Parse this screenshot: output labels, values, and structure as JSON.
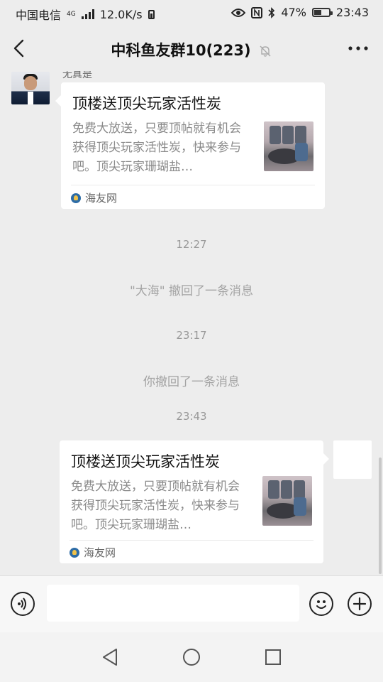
{
  "status_bar": {
    "carrier": "中国电信",
    "network_gen": "4G",
    "speed": "12.0K/s",
    "battery": "47%",
    "time": "23:43"
  },
  "header": {
    "title": "中科鱼友群10(223)"
  },
  "messages": {
    "first": {
      "sender_name": "无真是",
      "title": "顶楼送顶尖玩家活性炭",
      "description": "免费大放送，只要顶帖就有机会获得顶尖玩家活性炭，快来参与吧。顶尖玩家珊瑚盐…",
      "source": "海友网"
    },
    "ts1": "12:27",
    "sys1": "\"大海\" 撤回了一条消息",
    "ts2": "23:17",
    "sys2": "你撤回了一条消息",
    "ts3": "23:43",
    "second": {
      "title": "顶楼送顶尖玩家活性炭",
      "description": "免费大放送，只要顶帖就有机会获得顶尖玩家活性炭，快来参与吧。顶尖玩家珊瑚盐…",
      "source": "海友网"
    }
  },
  "input": {
    "value": ""
  },
  "colors": {
    "background": "#ededed",
    "bubble": "#ffffff",
    "muted_text": "#8a8a8a"
  }
}
